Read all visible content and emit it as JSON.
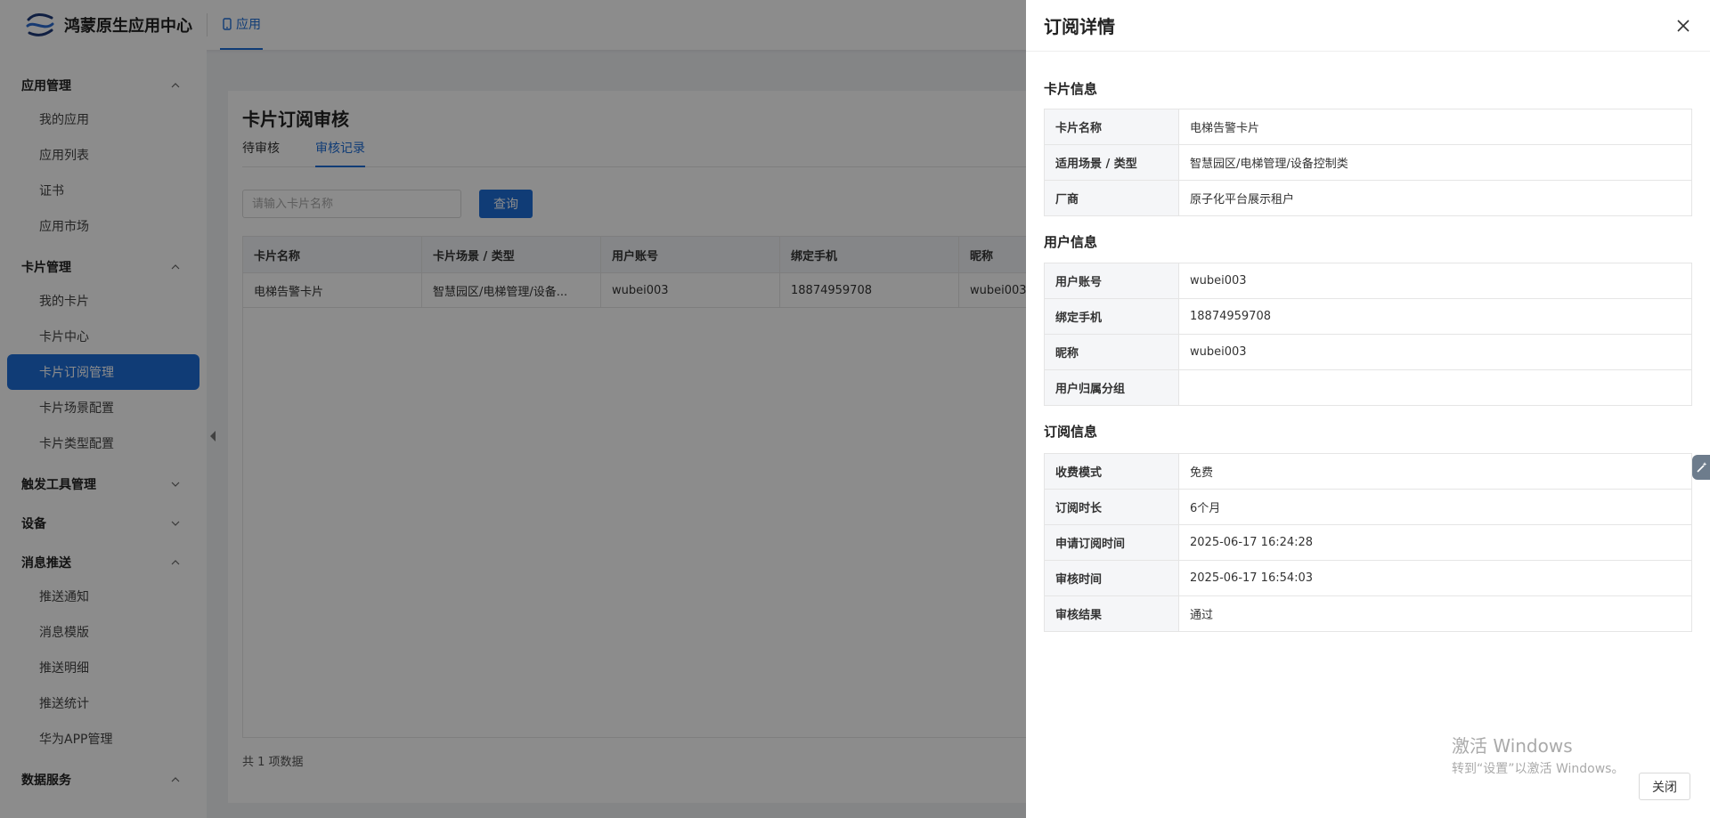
{
  "header": {
    "app_title": "鸿蒙原生应用中心",
    "nav_tab": "应用"
  },
  "sidebar": {
    "groups": [
      {
        "label": "应用管理",
        "expanded": true,
        "items": [
          "我的应用",
          "应用列表",
          "证书",
          "应用市场"
        ]
      },
      {
        "label": "卡片管理",
        "expanded": true,
        "items": [
          "我的卡片",
          "卡片中心",
          "卡片订阅管理",
          "卡片场景配置",
          "卡片类型配置"
        ]
      },
      {
        "label": "触发工具管理",
        "expanded": false,
        "items": []
      },
      {
        "label": "设备",
        "expanded": false,
        "items": []
      },
      {
        "label": "消息推送",
        "expanded": true,
        "items": [
          "推送通知",
          "消息模版",
          "推送明细",
          "推送统计",
          "华为APP管理"
        ]
      },
      {
        "label": "数据服务",
        "expanded": true,
        "items": []
      }
    ],
    "active_item": "卡片订阅管理"
  },
  "main": {
    "title": "卡片订阅审核",
    "tabs": [
      {
        "label": "待审核",
        "active": false
      },
      {
        "label": "审核记录",
        "active": true
      }
    ],
    "search": {
      "placeholder": "请输入卡片名称",
      "value": ""
    },
    "query_label": "查询",
    "table": {
      "columns": [
        "卡片名称",
        "卡片场景 / 类型",
        "用户账号",
        "绑定手机",
        "昵称"
      ],
      "rows": [
        [
          "电梯告警卡片",
          "智慧园区/电梯管理/设备...",
          "wubei003",
          "18874959708",
          "wubei003"
        ]
      ]
    },
    "total": "共 1 项数据"
  },
  "drawer": {
    "title": "订阅详情",
    "sections": [
      {
        "title": "卡片信息",
        "rows": [
          {
            "label": "卡片名称",
            "value": "电梯告警卡片"
          },
          {
            "label": "适用场景 / 类型",
            "value": "智慧园区/电梯管理/设备控制类"
          },
          {
            "label": "厂商",
            "value": "原子化平台展示租户"
          }
        ]
      },
      {
        "title": "用户信息",
        "rows": [
          {
            "label": "用户账号",
            "value": "wubei003"
          },
          {
            "label": "绑定手机",
            "value": "18874959708"
          },
          {
            "label": "昵称",
            "value": "wubei003"
          },
          {
            "label": "用户归属分组",
            "value": ""
          }
        ]
      },
      {
        "title": "订阅信息",
        "rows": [
          {
            "label": "收费模式",
            "value": "免费"
          },
          {
            "label": "订阅时长",
            "value": "6个月"
          },
          {
            "label": "申请订阅时间",
            "value": "2025-06-17 16:24:28"
          },
          {
            "label": "审核时间",
            "value": "2025-06-17 16:54:03"
          },
          {
            "label": "审核结果",
            "value": "通过"
          }
        ]
      }
    ],
    "close_label": "关闭"
  },
  "watermark": {
    "title": "激活 Windows",
    "subtitle": "转到“设置”以激活 Windows。"
  },
  "colors": {
    "accent": "#1e6ed8",
    "mask": "#000000"
  }
}
